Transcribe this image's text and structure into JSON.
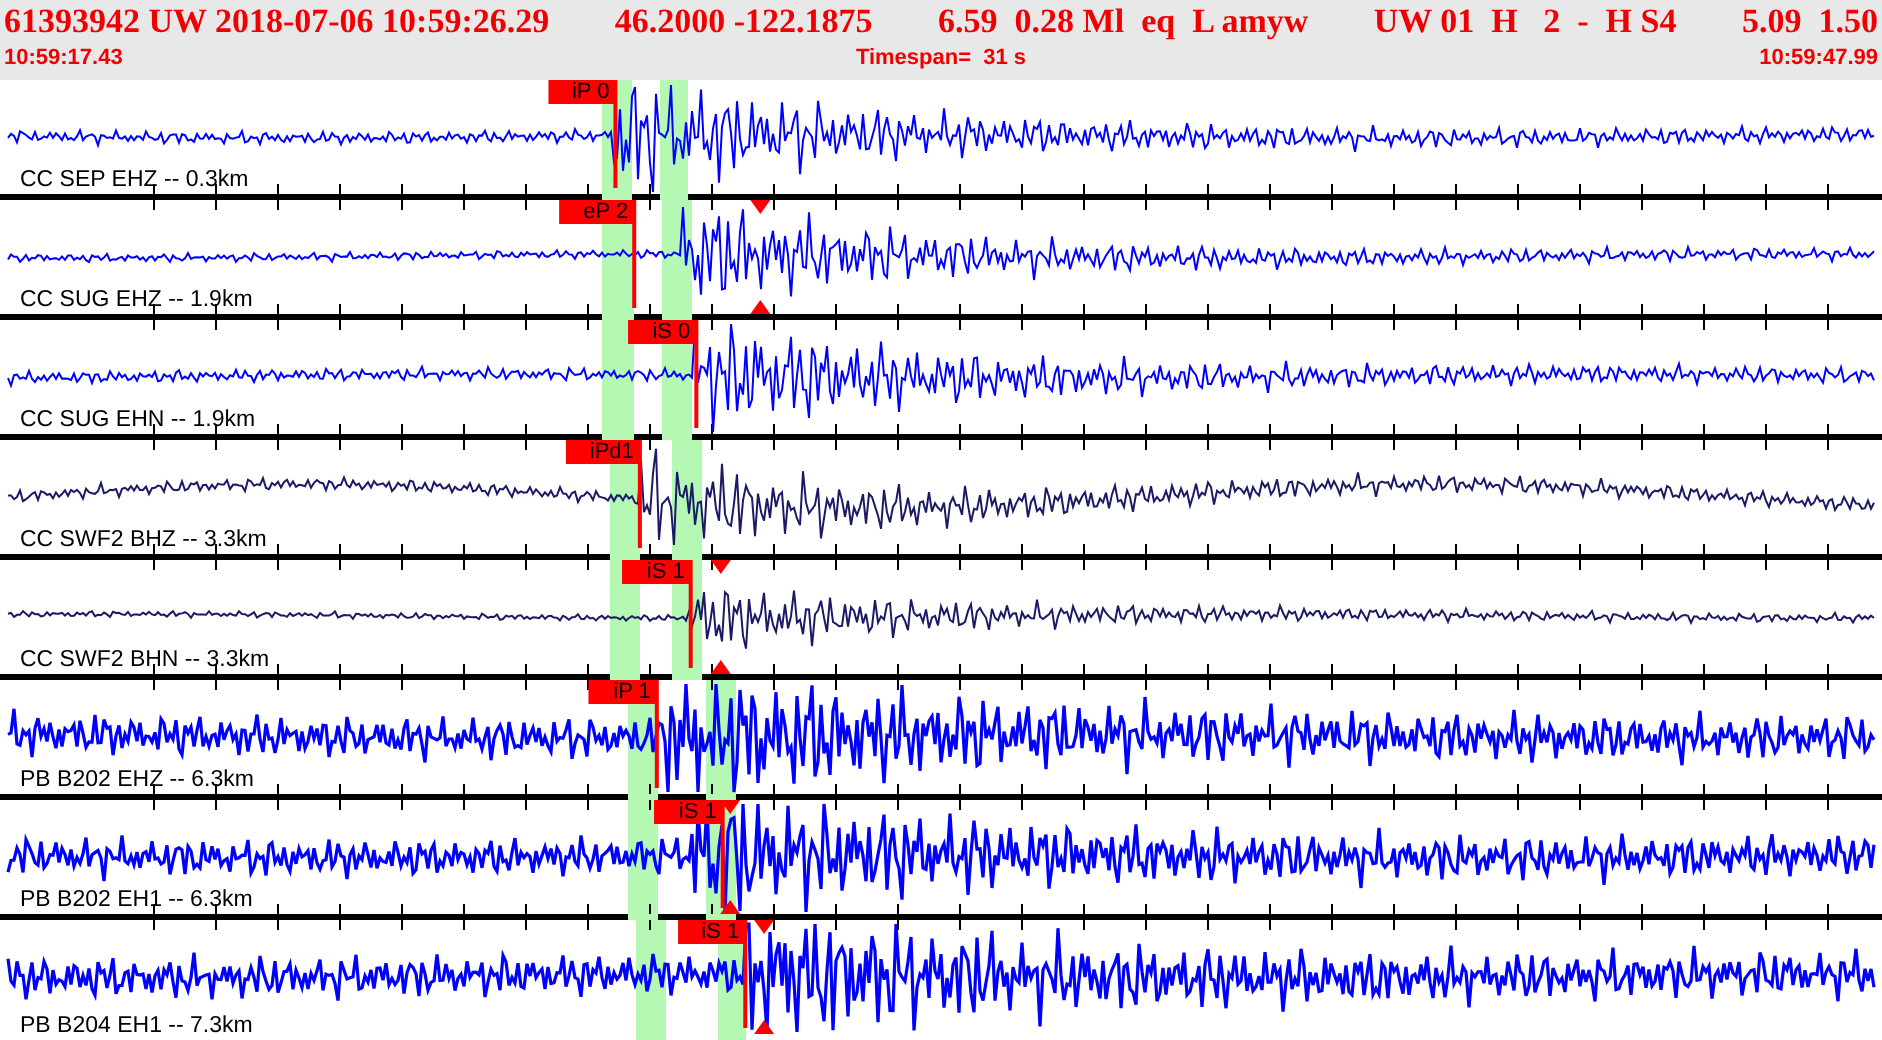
{
  "header": {
    "fields": [
      "61393942 UW 2018-07-06 10:59:26.29",
      "46.2000 -122.1875",
      "6.59  0.28 Ml  eq  L amyw",
      "UW 01  H   2  -  H S4",
      "5.09  1.50"
    ],
    "start_time": "10:59:17.43",
    "timespan": "Timespan=  31 s",
    "end_time": "10:59:47.99"
  },
  "traces": [
    {
      "station": "CC SEP EHZ -- 0.3km",
      "color": "#0000ff",
      "pick": {
        "label": "iP 0",
        "level": 0.327
      }
    },
    {
      "station": "CC SUG EHZ -- 1.9km",
      "color": "#0000ff",
      "pick": {
        "label": "eP 2",
        "level": 0.337
      },
      "marker": {
        "level": 0.404
      }
    },
    {
      "station": "CC SUG EHN -- 1.9km",
      "color": "#0000ff",
      "pick": {
        "label": "iS 0",
        "level": 0.37
      }
    },
    {
      "station": "CC SWF2 BHZ -- 3.3km",
      "color": "#1a1a66",
      "pick": {
        "label": "iPd1",
        "level": 0.34
      }
    },
    {
      "station": "CC SWF2 BHN -- 3.3km",
      "color": "#1a1a66",
      "pick": {
        "label": "iS 1",
        "level": 0.367
      },
      "marker": {
        "level": 0.383
      }
    },
    {
      "station": "PB B202 EHZ -- 6.3km",
      "color": "#0000ff",
      "pick": {
        "label": "iP 1",
        "level": 0.349
      }
    },
    {
      "station": "PB B202 EH1 -- 6.3km",
      "color": "#0000ff",
      "pick": {
        "label": "iS 1",
        "level": 0.384
      },
      "marker": {
        "level": 0.388
      }
    },
    {
      "station": "PB B204 EH1 -- 7.3km",
      "color": "#0000ff",
      "pick": {
        "label": "iS 1",
        "level": 0.396
      },
      "marker": {
        "level": 0.406
      }
    }
  ]
}
